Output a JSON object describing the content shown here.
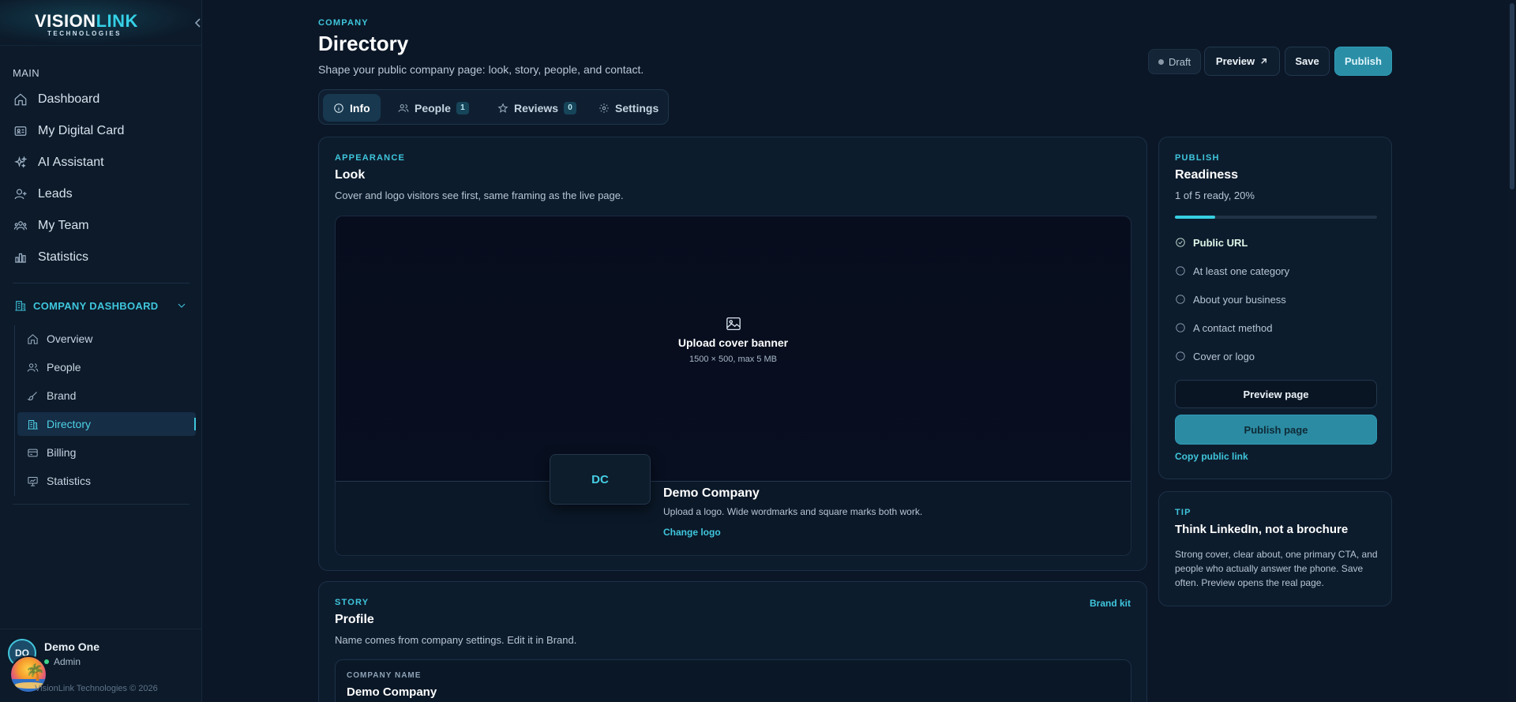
{
  "brand": {
    "word_a": "VISION",
    "word_b": "LINK",
    "sub": "TECHNOLOGIES"
  },
  "sidebar": {
    "main_label": "MAIN",
    "items": [
      {
        "label": "Dashboard",
        "icon": "home-icon"
      },
      {
        "label": "My Digital Card",
        "icon": "id-card-icon"
      },
      {
        "label": "AI Assistant",
        "icon": "sparkles-icon"
      },
      {
        "label": "Leads",
        "icon": "user-plus-icon"
      },
      {
        "label": "My Team",
        "icon": "team-icon"
      },
      {
        "label": "Statistics",
        "icon": "bar-chart-icon"
      }
    ],
    "company_label": "COMPANY DASHBOARD",
    "company_items": [
      {
        "label": "Overview",
        "icon": "home-icon"
      },
      {
        "label": "People",
        "icon": "users-icon"
      },
      {
        "label": "Brand",
        "icon": "brush-icon"
      },
      {
        "label": "Directory",
        "icon": "building-icon",
        "active": true
      },
      {
        "label": "Billing",
        "icon": "credit-card-icon"
      },
      {
        "label": "Statistics",
        "icon": "presentation-chart-icon"
      }
    ],
    "user": {
      "initials": "DO",
      "name": "Demo One",
      "role": "Admin"
    },
    "copyright": "VisionLink Technologies © 2026"
  },
  "header": {
    "eyebrow": "COMPANY",
    "title": "Directory",
    "subtitle": "Shape your public company page: look, story, people, and contact.",
    "status": "Draft",
    "preview_label": "Preview",
    "save_label": "Save",
    "publish_label": "Publish"
  },
  "tabs": [
    {
      "label": "Info",
      "icon": "info-icon",
      "active": true
    },
    {
      "label": "People",
      "icon": "users-icon",
      "count": "1"
    },
    {
      "label": "Reviews",
      "icon": "star-icon",
      "count": "0"
    },
    {
      "label": "Settings",
      "icon": "gear-icon"
    }
  ],
  "look": {
    "eyebrow": "APPEARANCE",
    "title": "Look",
    "desc": "Cover and logo visitors see first, same framing as the live page.",
    "upload_title": "Upload cover banner",
    "upload_sub": "1500 × 500, max 5 MB",
    "logo_initials": "DC",
    "company_name": "Demo Company",
    "logo_hint": "Upload a logo. Wide wordmarks and square marks both work.",
    "change_logo": "Change logo"
  },
  "profile": {
    "eyebrow": "STORY",
    "title": "Profile",
    "desc": "Name comes from company settings. Edit it in Brand.",
    "brand_kit": "Brand kit",
    "field_label": "COMPANY NAME",
    "field_value": "Demo Company"
  },
  "publish": {
    "eyebrow": "PUBLISH",
    "title": "Readiness",
    "summary": "1 of 5 ready, 20%",
    "progress": 0.2,
    "checklist": [
      {
        "label": "Public URL",
        "done": true
      },
      {
        "label": "At least one category",
        "done": false
      },
      {
        "label": "About your business",
        "done": false
      },
      {
        "label": "A contact method",
        "done": false
      },
      {
        "label": "Cover or logo",
        "done": false
      }
    ],
    "preview_page": "Preview page",
    "publish_page": "Publish page",
    "copy_link": "Copy public link"
  },
  "tip": {
    "eyebrow": "TIP",
    "title": "Think LinkedIn, not a brochure",
    "body": "Strong cover, clear about, one primary CTA, and people who actually answer the phone. Save often. Preview opens the real page."
  },
  "colors": {
    "accent": "#3fc6dc",
    "primary_button": "#2a8ea6",
    "background": "#0b1727",
    "success_dot": "#3ed38a"
  }
}
